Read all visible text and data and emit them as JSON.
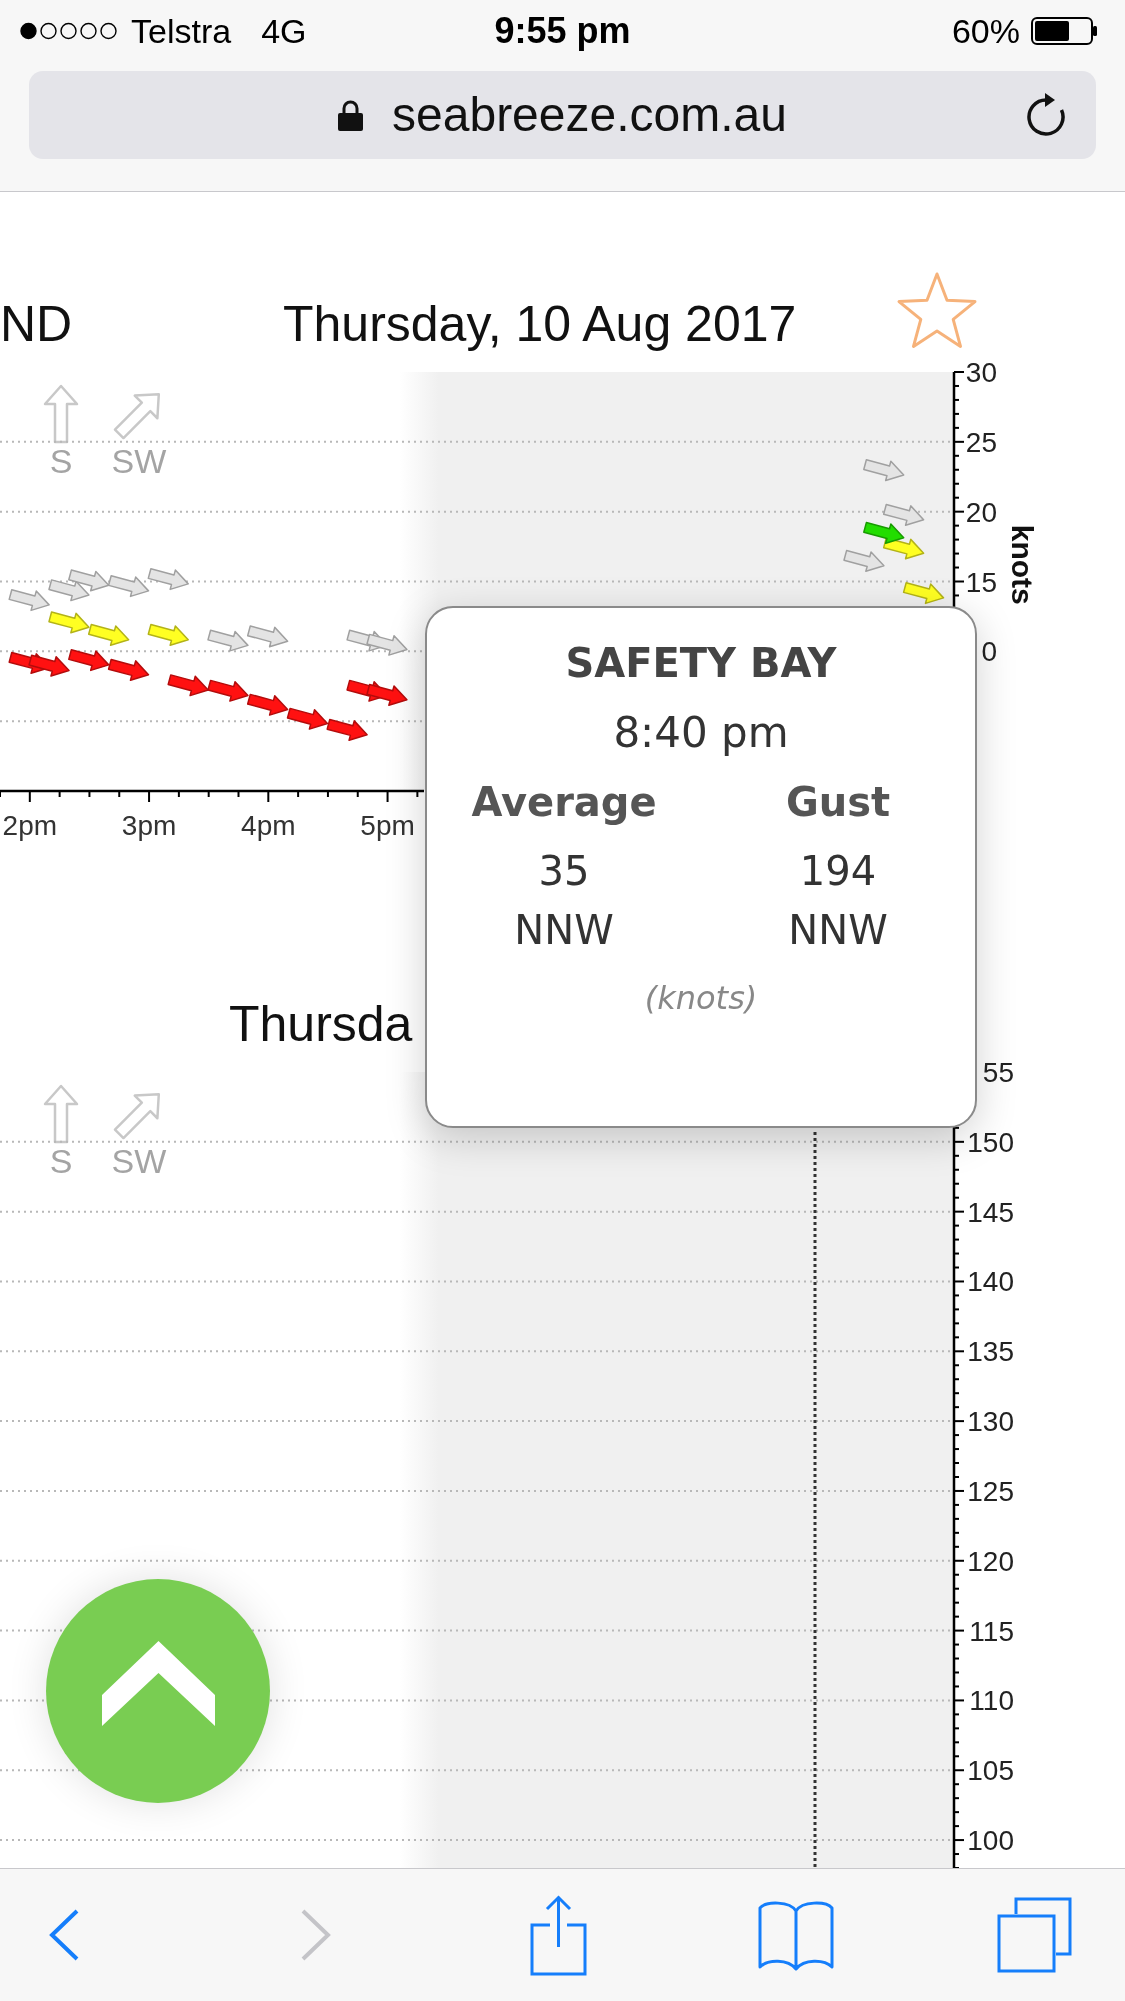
{
  "status_bar": {
    "carrier": "Telstra",
    "network": "4G",
    "time": "9:55 pm",
    "battery": "60%"
  },
  "address_bar": {
    "url": "seabreeze.com.au"
  },
  "upper_chart": {
    "side_label": "ND",
    "date": "Thursday, 10 Aug 2017",
    "starred": false,
    "directions": [
      {
        "label": "S"
      },
      {
        "label": "SW"
      }
    ],
    "partial_tick_label": {
      "label": "0",
      "below": true
    },
    "chart_data": {
      "type": "scatter",
      "ylabel": "knots",
      "grid": true,
      "categories": [
        null,
        "2pm",
        null,
        null,
        null,
        null,
        null,
        "3pm",
        null,
        null,
        null,
        null,
        null,
        "4pm",
        null,
        null,
        null,
        null,
        null,
        "5pm",
        null,
        null,
        null,
        null,
        null,
        null,
        null,
        null,
        null,
        null,
        null,
        null,
        null,
        null,
        null,
        null,
        null,
        null,
        null,
        null,
        null,
        null,
        null,
        null,
        null,
        null,
        null,
        null
      ],
      "series": [
        {
          "color": "#e4e4e4",
          "values": [
            null,
            13.7,
            null,
            14.4,
            15.1,
            null,
            14.7,
            null,
            15.2,
            null,
            null,
            10.8,
            null,
            11.1,
            null,
            null,
            null,
            null,
            10.8,
            10.5,
            null,
            null,
            null,
            null,
            null,
            null,
            null,
            null,
            null,
            null,
            null,
            null,
            null,
            null,
            null,
            null,
            null,
            null,
            null,
            null,
            null,
            null,
            null,
            16.5,
            23.0,
            19.8,
            null,
            null
          ]
        },
        {
          "color": "#ff1111",
          "values": [
            null,
            9.2,
            9.0,
            null,
            9.4,
            null,
            8.7,
            null,
            null,
            7.6,
            null,
            7.2,
            null,
            6.2,
            null,
            5.2,
            null,
            4.4,
            7.2,
            6.9,
            null,
            null,
            null,
            null,
            null,
            null,
            null,
            null,
            null,
            null,
            null,
            null,
            null,
            null,
            null,
            null,
            null,
            null,
            null,
            null,
            null,
            null,
            null,
            null,
            null,
            null,
            null,
            null
          ]
        },
        {
          "color": "#ffff22",
          "values": [
            null,
            null,
            null,
            12.1,
            null,
            11.2,
            null,
            null,
            11.2,
            null,
            null,
            null,
            null,
            null,
            null,
            null,
            null,
            null,
            null,
            null,
            null,
            null,
            null,
            null,
            null,
            null,
            null,
            null,
            null,
            null,
            null,
            null,
            null,
            null,
            null,
            null,
            null,
            null,
            null,
            null,
            null,
            null,
            null,
            null,
            null,
            17.4,
            14.2,
            null
          ]
        },
        {
          "color": "#22dd00",
          "values": [
            null,
            null,
            null,
            null,
            null,
            null,
            null,
            null,
            null,
            null,
            null,
            null,
            null,
            null,
            null,
            null,
            null,
            null,
            null,
            null,
            null,
            null,
            null,
            null,
            null,
            null,
            null,
            null,
            null,
            null,
            null,
            null,
            null,
            null,
            null,
            null,
            null,
            null,
            null,
            null,
            null,
            null,
            null,
            null,
            18.5,
            null,
            null,
            null
          ]
        }
      ],
      "ylim": [
        0,
        30
      ],
      "yticks": [
        15,
        20,
        25,
        30
      ]
    }
  },
  "lower_chart": {
    "date": "Thursda",
    "directions": [
      {
        "label": "S"
      },
      {
        "label": "SW"
      }
    ],
    "partial_tick_label": {
      "label": "55",
      "below": false
    },
    "chart_data": {
      "type": "scatter",
      "grid": true,
      "categories": [
        null,
        null,
        null,
        null,
        null,
        null,
        null,
        null,
        null,
        null,
        null,
        null,
        null,
        null,
        null,
        null,
        null,
        null,
        null,
        null,
        null,
        null,
        null,
        null,
        null,
        null,
        null,
        null,
        null,
        null,
        null,
        null,
        null,
        null,
        null,
        null,
        null,
        null,
        null,
        null,
        null,
        null,
        null,
        null,
        null,
        null,
        null,
        null
      ],
      "ylim": [
        98,
        155
      ],
      "yticks": [
        100,
        105,
        110,
        115,
        120,
        125,
        130,
        135,
        140,
        145,
        150
      ]
    }
  },
  "tooltip": {
    "station": "SAFETY BAY",
    "time": "8:40 pm",
    "columns": [
      {
        "heading": "Average",
        "speed": "35",
        "direction": "NNW"
      },
      {
        "heading": "Gust",
        "speed": "194",
        "direction": "NNW"
      }
    ],
    "unit": "(knots)"
  },
  "toolbar": [
    {
      "kind": "back",
      "disabled": false
    },
    {
      "kind": "forward",
      "disabled": true
    },
    {
      "kind": "share",
      "disabled": false
    },
    {
      "kind": "bookmarks",
      "disabled": false
    },
    {
      "kind": "tabs",
      "disabled": false
    }
  ]
}
